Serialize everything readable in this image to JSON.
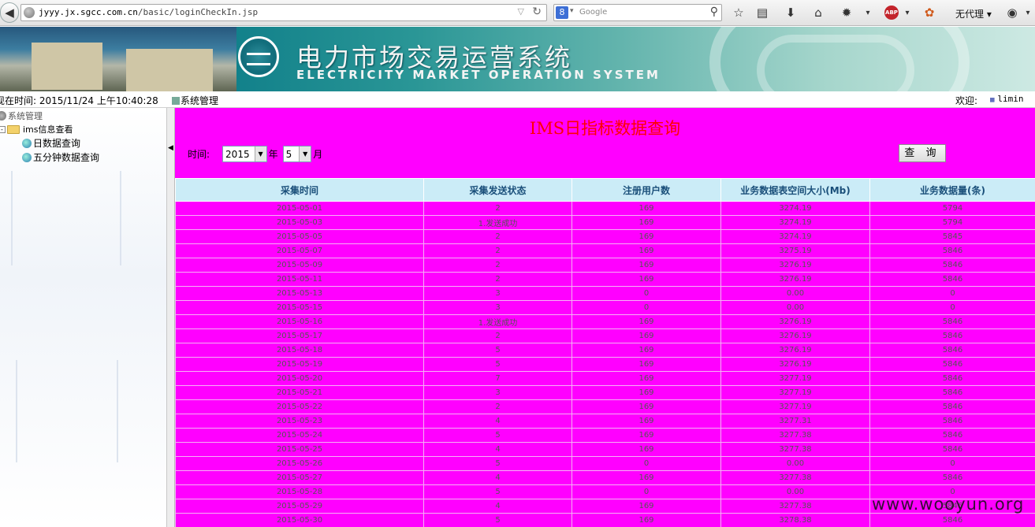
{
  "browser": {
    "url_host": "jyyy.jx.sgcc.com.cn",
    "url_path": "/basic/loginCheckIn.jsp",
    "search_engine": "8",
    "search_placeholder": "Google",
    "abp_label": "ABP",
    "proxy_label": "无代理"
  },
  "banner": {
    "title_cn": "电力市场交易运营系统",
    "title_en": "ELECTRICITY MARKET OPERATION SYSTEM"
  },
  "infobar": {
    "current_time": "现在时间:  2015/11/24 上午10:40:28",
    "menu_label": "系统管理",
    "welcome_label": "欢迎:",
    "username": "limin"
  },
  "sidebar": {
    "root": "系统管理",
    "folder": "ims信息查看",
    "items": [
      "日数据查询",
      "五分钟数据查询"
    ]
  },
  "main": {
    "title": "IMS日指标数据查询",
    "time_label": "时间:",
    "year_value": "2015",
    "year_unit": "年",
    "month_value": "5",
    "month_unit": "月",
    "query_button": "查 询",
    "columns": [
      "采集时间",
      "采集发送状态",
      "注册用户数",
      "业务数据表空间大小(Mb)",
      "业务数据量(条)"
    ],
    "rows": [
      [
        "2015-05-01",
        "2",
        "169",
        "3274.19",
        "5794"
      ],
      [
        "2015-05-03",
        "1.发送成功",
        "169",
        "3274.19",
        "5794"
      ],
      [
        "2015-05-05",
        "2",
        "169",
        "3274.19",
        "5845"
      ],
      [
        "2015-05-07",
        "2",
        "169",
        "3275.19",
        "5846"
      ],
      [
        "2015-05-09",
        "2",
        "169",
        "3276.19",
        "5846"
      ],
      [
        "2015-05-11",
        "2",
        "169",
        "3276.19",
        "5846"
      ],
      [
        "2015-05-13",
        "3",
        "0",
        "0.00",
        "0"
      ],
      [
        "2015-05-15",
        "3",
        "0",
        "0.00",
        "0"
      ],
      [
        "2015-05-16",
        "1.发送成功",
        "169",
        "3276.19",
        "5846"
      ],
      [
        "2015-05-17",
        "2",
        "169",
        "3276.19",
        "5846"
      ],
      [
        "2015-05-18",
        "5",
        "169",
        "3276.19",
        "5846"
      ],
      [
        "2015-05-19",
        "5",
        "169",
        "3276.19",
        "5846"
      ],
      [
        "2015-05-20",
        "7",
        "169",
        "3277.19",
        "5846"
      ],
      [
        "2015-05-21",
        "3",
        "169",
        "3277.19",
        "5846"
      ],
      [
        "2015-05-22",
        "2",
        "169",
        "3277.19",
        "5846"
      ],
      [
        "2015-05-23",
        "4",
        "169",
        "3277.31",
        "5846"
      ],
      [
        "2015-05-24",
        "5",
        "169",
        "3277.38",
        "5846"
      ],
      [
        "2015-05-25",
        "4",
        "169",
        "3277.38",
        "5846"
      ],
      [
        "2015-05-26",
        "5",
        "0",
        "0.00",
        "0"
      ],
      [
        "2015-05-27",
        "4",
        "169",
        "3277.38",
        "5846"
      ],
      [
        "2015-05-28",
        "5",
        "0",
        "0.00",
        "0"
      ],
      [
        "2015-05-29",
        "4",
        "169",
        "3277.38",
        "5846"
      ],
      [
        "2015-05-30",
        "5",
        "169",
        "3278.38",
        "5846"
      ]
    ]
  },
  "watermark": "www.wooyun.org",
  "colors": {
    "page_bg": "#ff00ff",
    "title": "#ff0000",
    "header_bg": "#cbecf7"
  }
}
